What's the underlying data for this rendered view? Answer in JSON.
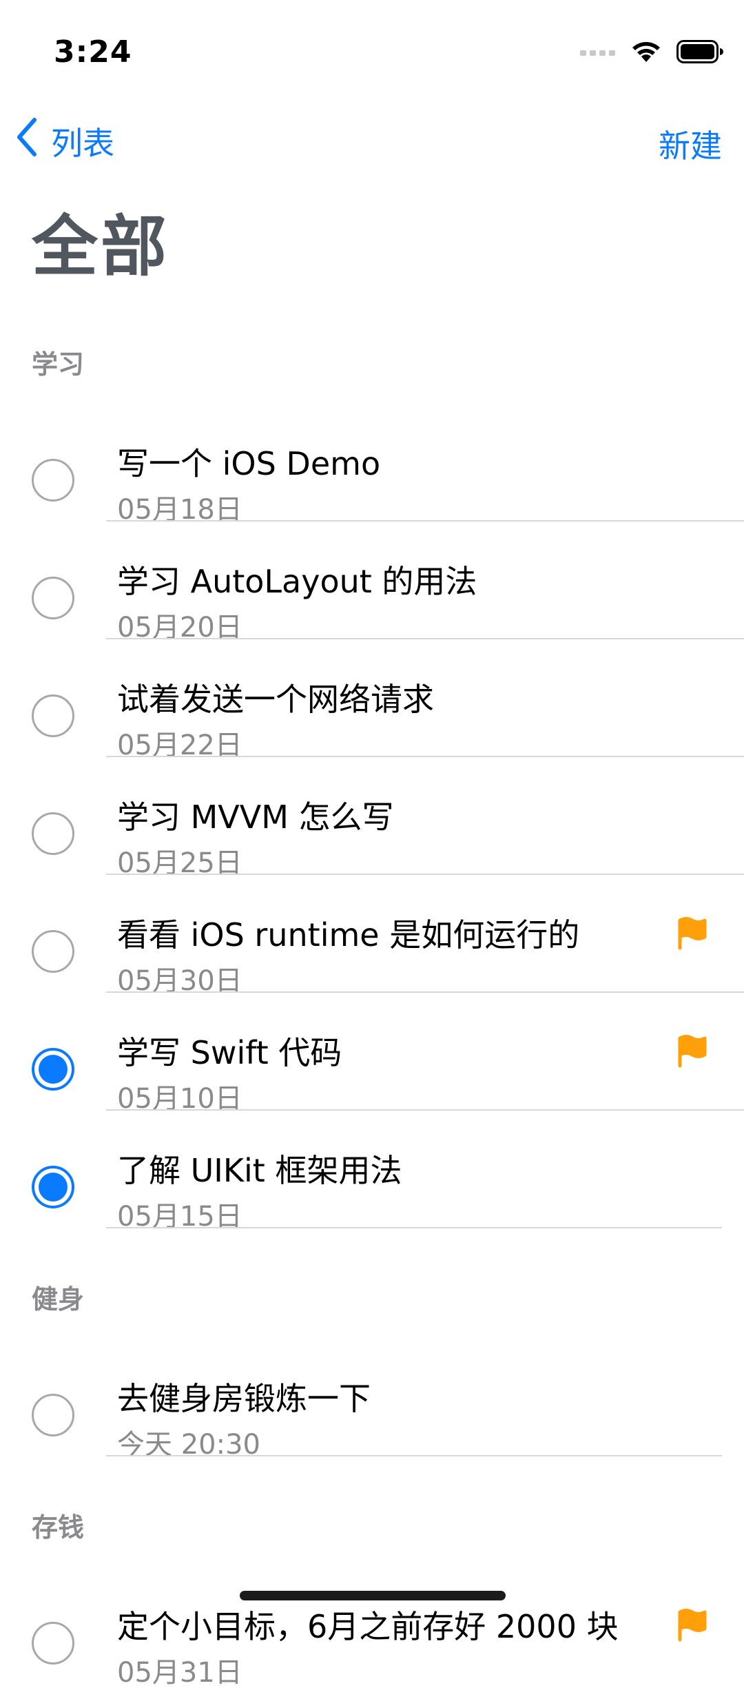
{
  "status_bar": {
    "time": "3:24",
    "icons": [
      "cellular-signal-icon",
      "wifi-icon",
      "battery-icon"
    ]
  },
  "nav": {
    "back_label": "列表",
    "new_label": "新建",
    "accent_color": "#0A7AFF"
  },
  "page_title": "全部",
  "sections": [
    {
      "header": "学习",
      "items": [
        {
          "title": "写一个 iOS Demo",
          "date": "05月18日",
          "completed": false,
          "flagged": false
        },
        {
          "title": "学习 AutoLayout 的用法",
          "date": "05月20日",
          "completed": false,
          "flagged": false
        },
        {
          "title": "试着发送一个网络请求",
          "date": "05月22日",
          "completed": false,
          "flagged": false
        },
        {
          "title": "学习 MVVM 怎么写",
          "date": "05月25日",
          "completed": false,
          "flagged": false
        },
        {
          "title": "看看 iOS runtime 是如何运行的",
          "date": "05月30日",
          "completed": false,
          "flagged": true
        },
        {
          "title": "学写 Swift 代码",
          "date": "05月10日",
          "completed": true,
          "flagged": true
        },
        {
          "title": "了解 UIKit 框架用法",
          "date": "05月15日",
          "completed": true,
          "flagged": false
        }
      ]
    },
    {
      "header": "健身",
      "items": [
        {
          "title": "去健身房锻炼一下",
          "date": "今天 20:30",
          "completed": false,
          "flagged": false
        }
      ]
    },
    {
      "header": "存钱",
      "items": [
        {
          "title": "定个小目标，6月之前存好 2000 块",
          "date": "05月31日",
          "completed": false,
          "flagged": true
        }
      ]
    }
  ],
  "flag_color": "#FF9F0A"
}
